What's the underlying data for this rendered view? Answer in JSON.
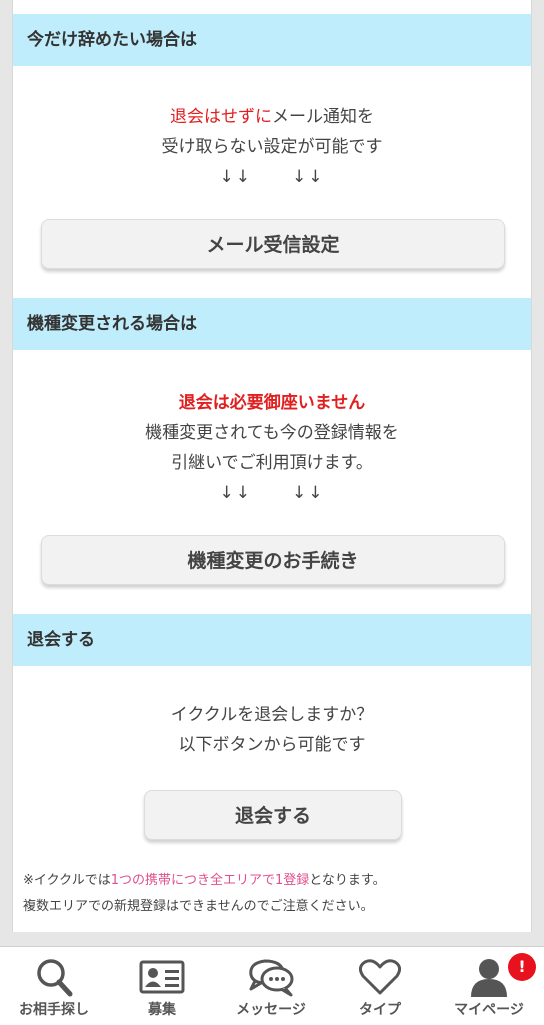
{
  "sections": {
    "quit_now": {
      "heading": "今だけ辞めたい場合は",
      "line1_red": "退会はせずに",
      "line1_rest": "メール通知を",
      "line2": "受け取らない設定が可能です",
      "arrow1": "↓↓",
      "arrow2": "↓↓",
      "button": "メール受信設定"
    },
    "device_change": {
      "heading": "機種変更される場合は",
      "line1_red": "退会は必要御座いません",
      "line2": "機種変更されても今の登録情報を",
      "line3": "引継いでご利用頂けます。",
      "arrow1": "↓↓",
      "arrow2": "↓↓",
      "button": "機種変更のお手続き"
    },
    "withdraw": {
      "heading": "退会する",
      "line1": "イククルを退会しますか？",
      "line2": "以下ボタンから可能です",
      "button": "退会する"
    }
  },
  "note": {
    "prefix": "※イククルでは",
    "highlight": "1つの携帯につき全エリアで1登録",
    "suffix": "となります。",
    "line2": "複数エリアでの新規登録はできませんのでご注意ください。"
  },
  "tabbar": {
    "items": [
      {
        "label": "お相手探し",
        "icon": "search-icon"
      },
      {
        "label": "募集",
        "icon": "profile-card-icon"
      },
      {
        "label": "メッセージ",
        "icon": "chat-bubbles-icon"
      },
      {
        "label": "タイプ",
        "icon": "heart-icon"
      },
      {
        "label": "マイページ",
        "icon": "person-icon"
      }
    ],
    "badge": "!"
  },
  "colors": {
    "section_header_bg": "#bfedfb",
    "alert_red": "#e02020",
    "link_pink": "#e0508e",
    "badge_red": "#e8121e"
  }
}
